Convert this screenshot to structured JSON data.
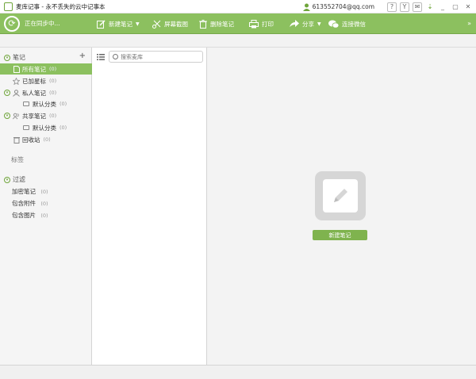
{
  "window": {
    "title": "麦库记事 - 永不丢失的云中记事本",
    "account": "613552704@qq.com",
    "controls": [
      "?",
      "Y",
      "✉",
      "_",
      "▢",
      "✕"
    ]
  },
  "toolbar": {
    "sync_status": "正在同步中...",
    "new_note": "新建笔记",
    "screenshot": "屏幕截图",
    "delete_note": "删除笔记",
    "print": "打印",
    "share": "分享",
    "wechat": "连接微信"
  },
  "sidebar": {
    "notes_header": "笔记",
    "all_notes": {
      "label": "所有笔记",
      "count": "(0)"
    },
    "starred": {
      "label": "已加星标",
      "count": "(0)"
    },
    "private_notes": {
      "label": "私人笔记",
      "count": "(0)"
    },
    "private_default": {
      "label": "默认分类",
      "count": "(0)"
    },
    "shared_notes": {
      "label": "共享笔记",
      "count": "(0)"
    },
    "shared_default": {
      "label": "默认分类",
      "count": "(0)"
    },
    "trash": {
      "label": "回收站",
      "count": "(0)"
    },
    "tags_header": "标签",
    "filter_header": "过滤",
    "encrypted": {
      "label": "加密笔记",
      "count": "(0)"
    },
    "with_attachments": {
      "label": "包含附件",
      "count": "(0)"
    },
    "with_images": {
      "label": "包含图片",
      "count": "(0)"
    }
  },
  "notelist": {
    "search_placeholder": "搜索麦库"
  },
  "content": {
    "new_note_button": "新建笔记"
  },
  "colors": {
    "accent": "#8cc05f",
    "accent_dark": "#6fa53a"
  }
}
